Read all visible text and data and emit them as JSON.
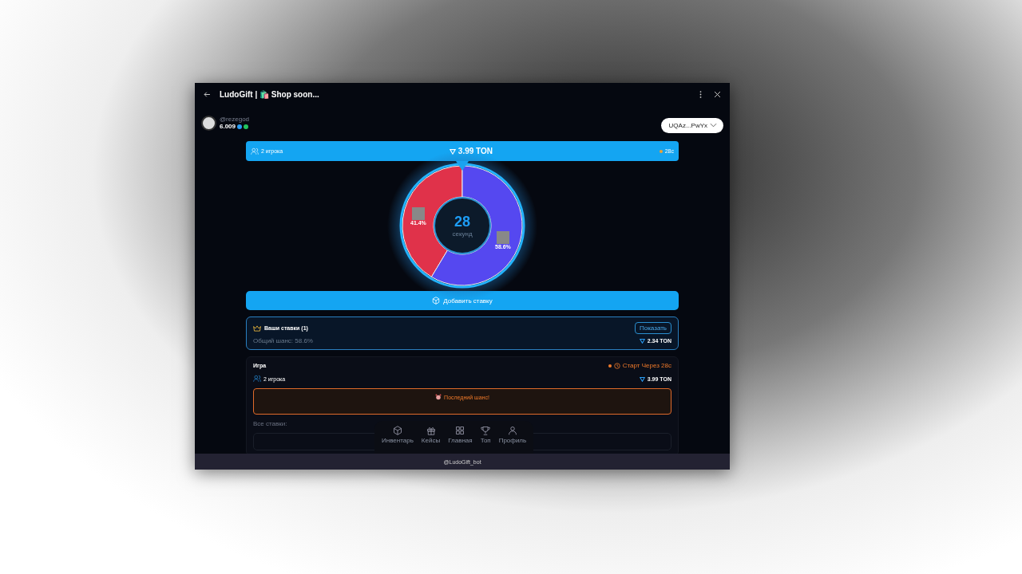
{
  "window": {
    "title": "LudoGift | 🛍️ Shop soon..."
  },
  "user": {
    "handle": "@rezegod",
    "balance": "6.009"
  },
  "wallet": {
    "label": "UQAz...PwYx"
  },
  "round_bar": {
    "players": "2 игрока",
    "pot": "3.99 TON",
    "timer": "28с"
  },
  "countdown": {
    "value": "28",
    "unit": "секунд"
  },
  "chart_data": {
    "type": "donut",
    "values": [
      41.4,
      58.6
    ],
    "value_labels": [
      "41.4%",
      "58.6%"
    ]
  },
  "add_bet": {
    "label": "Добавить ставку"
  },
  "your_bets": {
    "title": "Ваши ставки (1)",
    "chance": "Общий шанс: 58.6%",
    "show_button": "Показать",
    "amount": "2.34 TON"
  },
  "game": {
    "title": "Игра",
    "status": "Старт Через 28с",
    "players": "2 игрока",
    "pot": "3.99 TON",
    "last_chance": "Последний шанс!",
    "all_bets_label": "Все ставки:"
  },
  "nav": [
    {
      "label": "Инвентарь",
      "kind": "cube"
    },
    {
      "label": "Кейсы",
      "kind": "gift"
    },
    {
      "label": "Главная",
      "kind": "grid"
    },
    {
      "label": "Топ",
      "kind": "trophy"
    },
    {
      "label": "Профиль",
      "kind": "person"
    }
  ],
  "footer": {
    "bot": "@LudoGift_bot"
  }
}
